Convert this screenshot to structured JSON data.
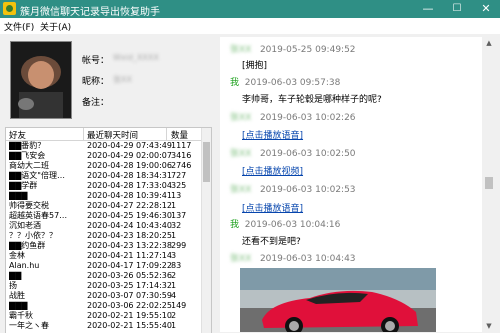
{
  "window": {
    "title": "簇月微信聊天记录导出恢复助手",
    "minimize": "—",
    "maximize": "☐",
    "close": "✕"
  },
  "menu": [
    {
      "label": "文件(F)"
    },
    {
      "label": "关于(A)"
    }
  ],
  "profile": {
    "account_label": "帐号：",
    "account_value": "Wxid_XXXX",
    "nickname_label": "昵称：",
    "nickname_value": "张XX",
    "remark_label": "备注：",
    "remark_value": ""
  },
  "friends_table": {
    "columns": [
      "好友",
      "最近聊天时间",
      "数量"
    ],
    "rows": [
      {
        "name": "▇▇番豹？",
        "time": "2020-04-29 07:43:49",
        "count": "1117"
      },
      {
        "name": "▇▇飞安会",
        "time": "2020-04-29 02:00:07",
        "count": "3416"
      },
      {
        "name": "商幼大二班",
        "time": "2020-04-28 19:00:06",
        "count": "2746"
      },
      {
        "name": "▇▇语文\"倍理…",
        "time": "2020-04-28 18:34:31",
        "count": "727"
      },
      {
        "name": "▇▇学群",
        "time": "2020-04-28 17:33:04",
        "count": "325"
      },
      {
        "name": "▇▇▇",
        "time": "2020-04-28 10:39:41",
        "count": "13"
      },
      {
        "name": "帅得要交税",
        "time": "2020-04-27 22:28:12",
        "count": "1"
      },
      {
        "name": "超越英语春57…",
        "time": "2020-04-25 19:46:30",
        "count": "137"
      },
      {
        "name": "沉如老酒",
        "time": "2020-04-24 10:43:40",
        "count": "32"
      },
      {
        "name": "？？小依？？",
        "time": "2020-04-23 18:20:25",
        "count": "1"
      },
      {
        "name": "▇▇约鱼群",
        "time": "2020-04-23 13:22:38",
        "count": "299"
      },
      {
        "name": "金林",
        "time": "2020-04-21 11:27:14",
        "count": "3"
      },
      {
        "name": "Alan.hu",
        "time": "2020-04-17 17:09:22",
        "count": "83"
      },
      {
        "name": "▇▇",
        "time": "2020-03-26 05:52:36",
        "count": "2"
      },
      {
        "name": "扬",
        "time": "2020-03-25 17:14:32",
        "count": "1"
      },
      {
        "name": "战胜",
        "time": "2020-03-07 07:30:59",
        "count": "4"
      },
      {
        "name": "▇▇▇",
        "time": "2020-03-06 22:02:25",
        "count": "149"
      },
      {
        "name": "霸千秋",
        "time": "2020-02-21 19:55:10",
        "count": "2"
      },
      {
        "name": "一年之ヽ春",
        "time": "2020-02-21 15:55:40",
        "count": "1"
      }
    ]
  },
  "chat": {
    "messages": [
      {
        "sender": "张XX",
        "time": "2019-05-25 09:49:52",
        "type": "text",
        "text": "[拥抱]",
        "mine": false
      },
      {
        "sender": "我",
        "time": "2019-06-03 09:57:38",
        "type": "text",
        "text": "李帅哥，车子轮毂是哪种样子的呢?",
        "mine": true
      },
      {
        "sender": "张XX",
        "time": "2019-06-03 10:02:26",
        "type": "link",
        "text": "[点击播放语音]",
        "mine": false
      },
      {
        "sender": "张XX",
        "time": "2019-06-03 10:02:50",
        "type": "link",
        "text": "[点击播放视频]",
        "mine": false
      },
      {
        "sender": "张XX",
        "time": "2019-06-03 10:02:53",
        "type": "link",
        "text": "[点击播放语音]",
        "mine": false
      },
      {
        "sender": "我",
        "time": "2019-06-03 10:04:16",
        "type": "text",
        "text": "还看不到是吧?",
        "mine": true
      },
      {
        "sender": "张XX",
        "time": "2019-06-03 10:04:43",
        "type": "image",
        "text": "",
        "mine": false
      }
    ]
  },
  "scroll": {
    "up": "▲",
    "down": "▼"
  },
  "colors": {
    "titlebar": "#2f8f85",
    "me": "#1aa01a",
    "link": "#0645ad",
    "car": "#e0103a"
  }
}
